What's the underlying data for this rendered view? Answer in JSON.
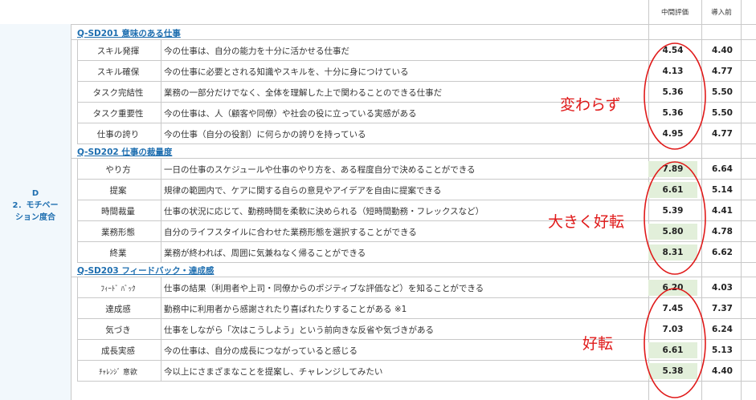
{
  "headers": {
    "mid": "中間評価",
    "pre": "導入前"
  },
  "left_label": {
    "line1": "D",
    "line2": "2．モチベー",
    "line3": "ション度合"
  },
  "sections": [
    {
      "title": "Q-SD201 意味のある仕事",
      "rows": [
        {
          "short": "スキル発揮",
          "long": "今の仕事は、自分の能力を十分に活かせる仕事だ",
          "mid": "4.54",
          "pre": "4.40",
          "highlight": false
        },
        {
          "short": "スキル確保",
          "long": "今の仕事に必要とされる知識やスキルを、十分に身につけている",
          "mid": "4.13",
          "pre": "4.77",
          "highlight": false
        },
        {
          "short": "タスク完結性",
          "long": "業務の一部分だけでなく、全体を理解した上で関わることのできる仕事だ",
          "mid": "5.36",
          "pre": "5.50",
          "highlight": false
        },
        {
          "short": "タスク重要性",
          "long": "今の仕事は、人（顧客や同僚）や社会の役に立っている実感がある",
          "mid": "5.36",
          "pre": "5.50",
          "highlight": false
        },
        {
          "short": "仕事の誇り",
          "long": "今の仕事（自分の役割）に何らかの誇りを持っている",
          "mid": "4.95",
          "pre": "4.77",
          "highlight": false
        }
      ]
    },
    {
      "title": "Q-SD202 仕事の裁量度",
      "rows": [
        {
          "short": "やり方",
          "long": "一日の仕事のスケジュールや仕事のやり方を、ある程度自分で決めることができる",
          "mid": "7.89",
          "pre": "6.64",
          "highlight": true
        },
        {
          "short": "提案",
          "long": "規律の範囲内で、ケアに関する自らの意見やアイデアを自由に提案できる",
          "mid": "6.61",
          "pre": "5.14",
          "highlight": true
        },
        {
          "short": "時間裁量",
          "long": "仕事の状況に応じて、勤務時間を柔軟に決められる（短時間勤務・フレックスなど）",
          "mid": "5.39",
          "pre": "4.41",
          "highlight": false
        },
        {
          "short": "業務形態",
          "long": "自分のライフスタイルに合わせた業務形態を選択することができる",
          "mid": "5.80",
          "pre": "4.78",
          "highlight": true
        },
        {
          "short": "終業",
          "long": "業務が終われば、周囲に気兼ねなく帰ることができる",
          "mid": "8.31",
          "pre": "6.62",
          "highlight": true
        }
      ]
    },
    {
      "title": "Q-SD203 フィードバック・達成感",
      "rows": [
        {
          "short": "ﾌｨｰﾄﾞ ﾊﾞｯｸ",
          "long": "仕事の結果（利用者や上司・同僚からのポジティブな評価など）を知ることができる",
          "mid": "6.20",
          "pre": "4.03",
          "highlight": true,
          "small": true
        },
        {
          "short": "達成感",
          "long": "勤務中に利用者から感謝されたり喜ばれたりすることがある ※1",
          "mid": "7.45",
          "pre": "7.37",
          "highlight": false
        },
        {
          "short": "気づき",
          "long": "仕事をしながら「次はこうしよう」という前向きな反省や気づきがある",
          "mid": "7.03",
          "pre": "6.24",
          "highlight": false
        },
        {
          "short": "成長実感",
          "long": "今の仕事は、自分の成長につながっていると感じる",
          "mid": "6.61",
          "pre": "5.13",
          "highlight": true
        },
        {
          "short": "ﾁｬﾚﾝｼﾞ 意欲",
          "long": "今以上にさまざまなことを提案し、チャレンジしてみたい",
          "mid": "5.38",
          "pre": "4.40",
          "highlight": true,
          "small": true
        }
      ]
    }
  ],
  "annotations": {
    "unchanged": "変わらず",
    "greatly_improved": "大きく好転",
    "improved": "好転"
  },
  "colors": {
    "accent_blue": "#1f6fb0",
    "highlight_green": "#e2efda",
    "annotation_red": "#e01a1a"
  }
}
